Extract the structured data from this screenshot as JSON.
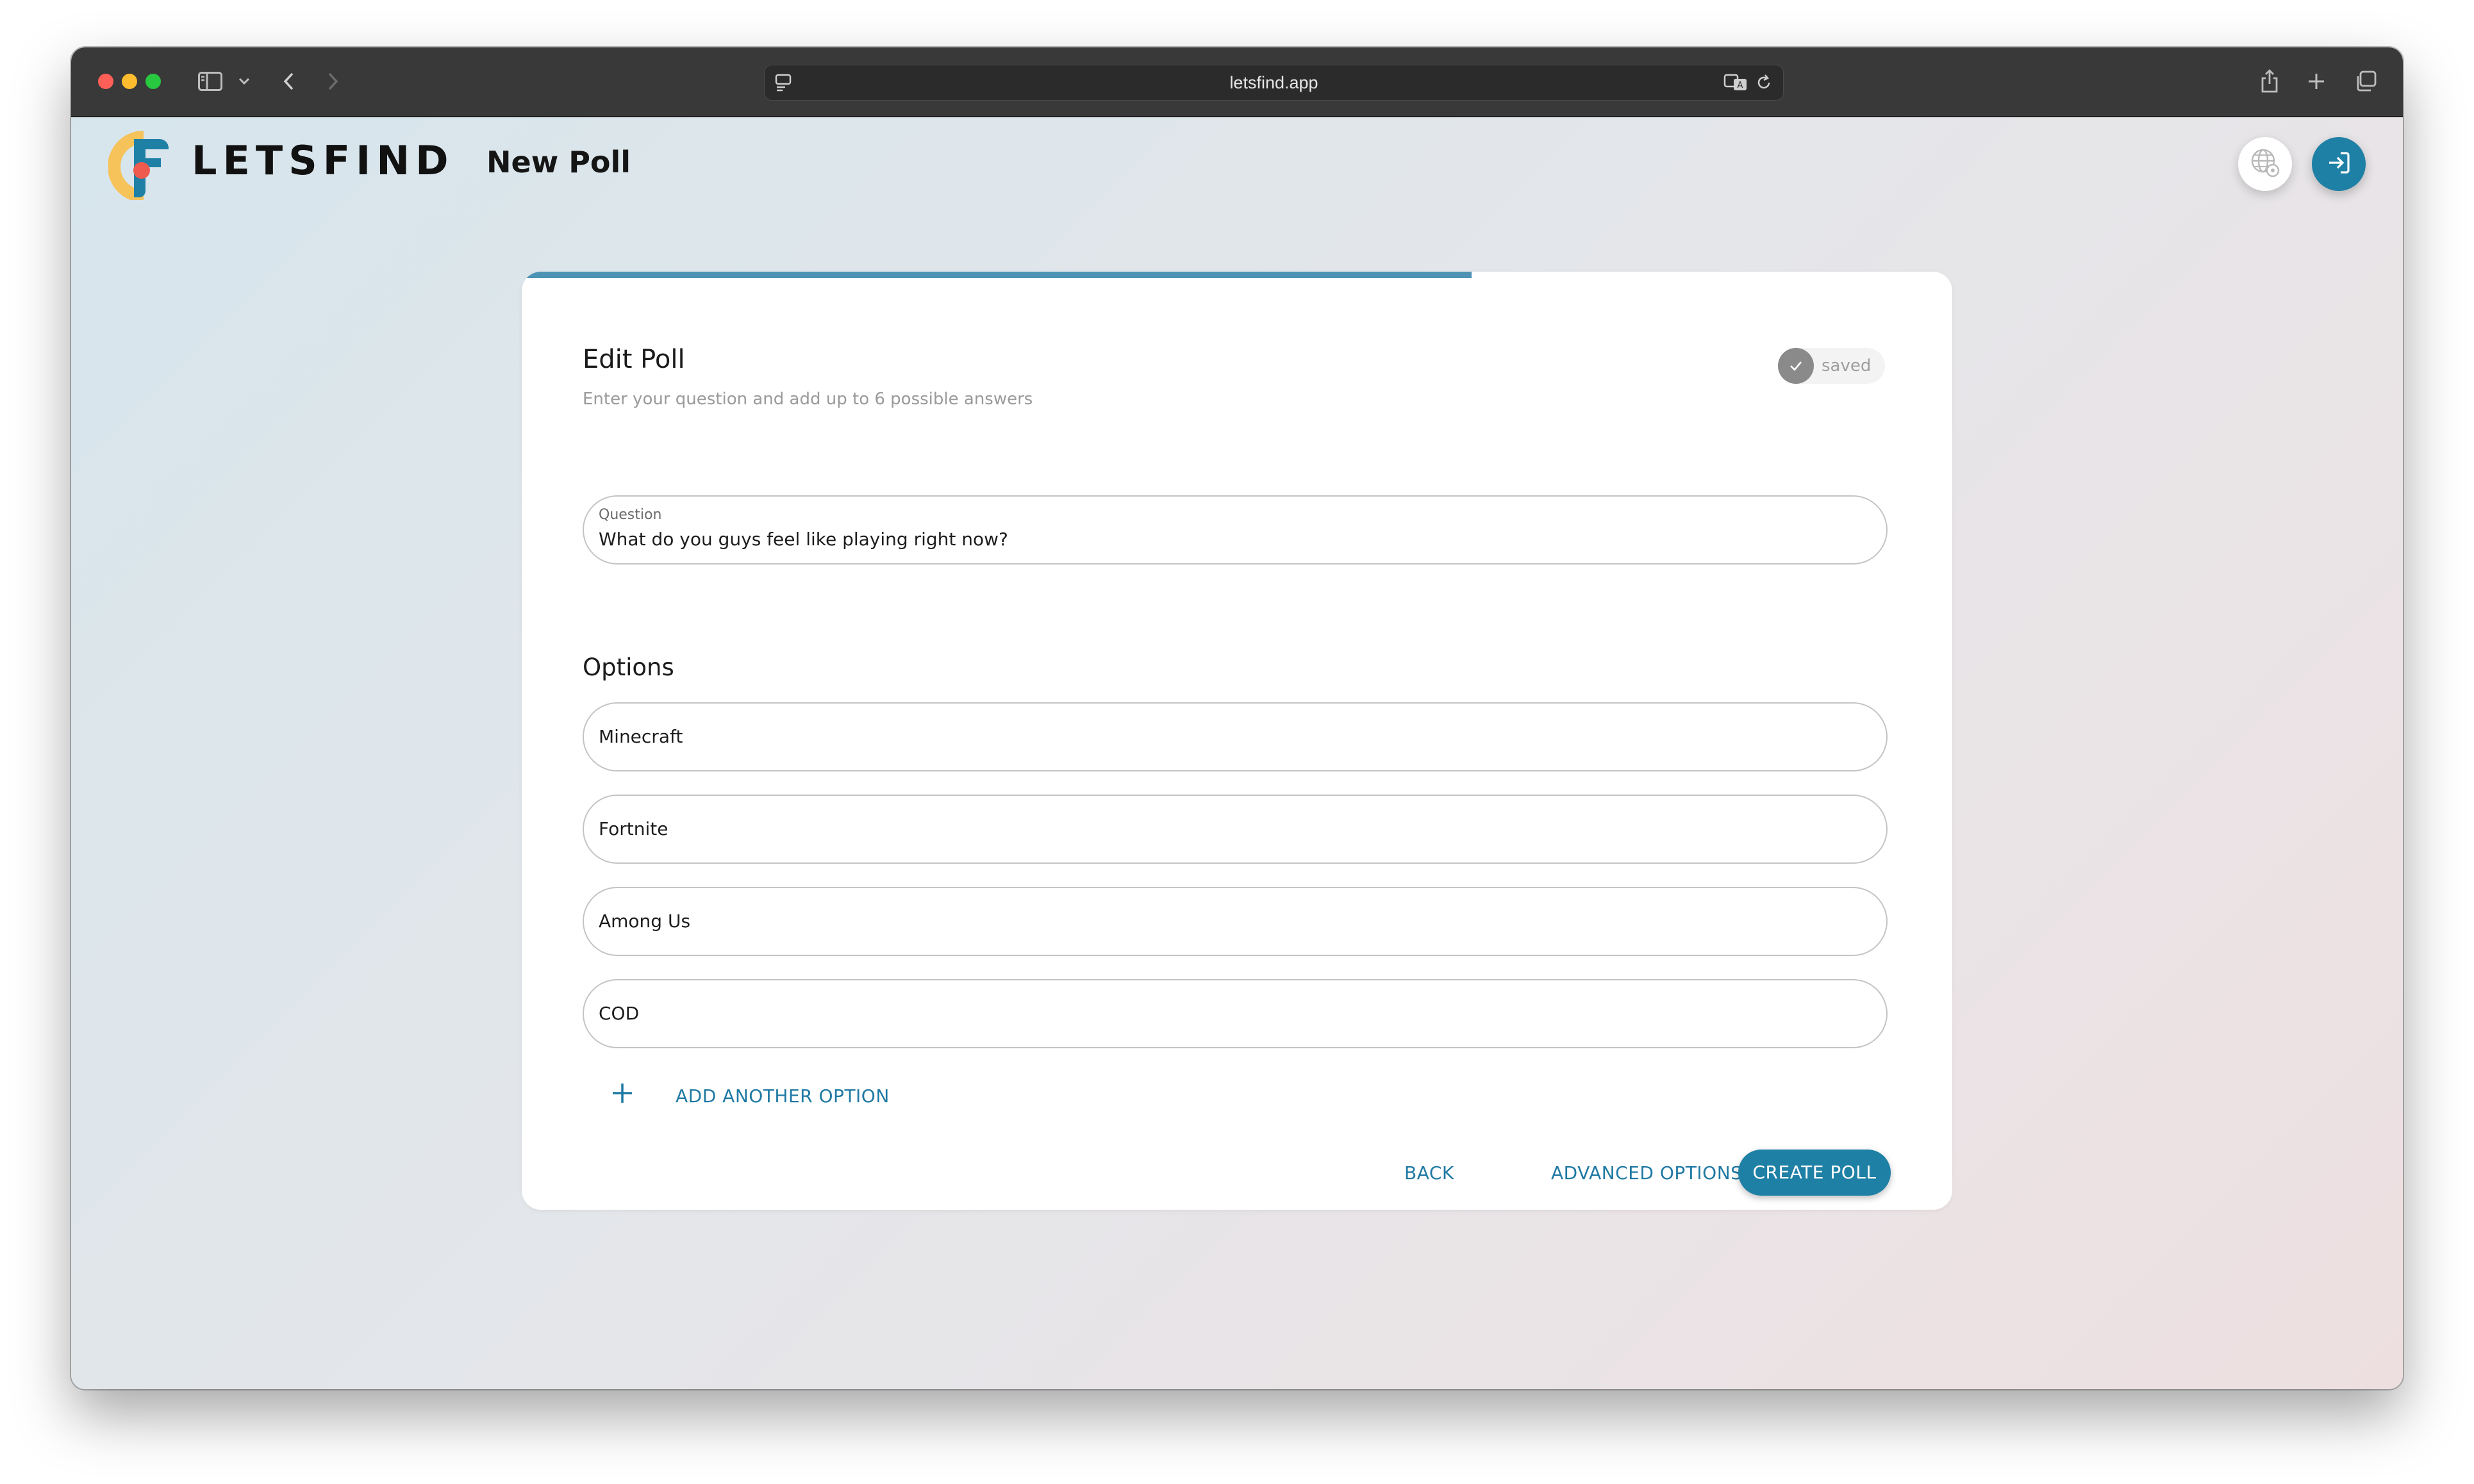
{
  "browser": {
    "url": "letsfind.app",
    "icons": [
      "sidebar-icon",
      "chevron-down-icon",
      "back-icon",
      "forward-icon",
      "page-icon",
      "translate-icon",
      "reload-icon",
      "share-icon",
      "new-tab-icon",
      "tabs-overview-icon"
    ]
  },
  "header": {
    "brand": "LETSFIND",
    "page_title": "New Poll",
    "logo_colors": [
      "#f6c25a",
      "#ef5b4e",
      "#1f80a6"
    ],
    "icons": [
      "language-settings-icon",
      "login-icon"
    ]
  },
  "card": {
    "progress": 0.664,
    "title": "Edit Poll",
    "subtitle": "Enter your question and add up to 6 possible answers",
    "saved_label": "saved",
    "question": {
      "label": "Question",
      "value": "What do you guys feel like playing right now?"
    },
    "options_title": "Options",
    "options": [
      {
        "value": "Minecraft"
      },
      {
        "value": "Fortnite"
      },
      {
        "value": "Among Us"
      },
      {
        "value": "COD"
      }
    ],
    "add_option_label": "ADD ANOTHER OPTION",
    "back_label": "BACK",
    "advanced_label": "ADVANCED OPTIONS",
    "create_label": "CREATE POLL"
  },
  "colors": {
    "accent": "#1f80a6",
    "progress": "#4d93b4",
    "link": "#1f79a3"
  }
}
